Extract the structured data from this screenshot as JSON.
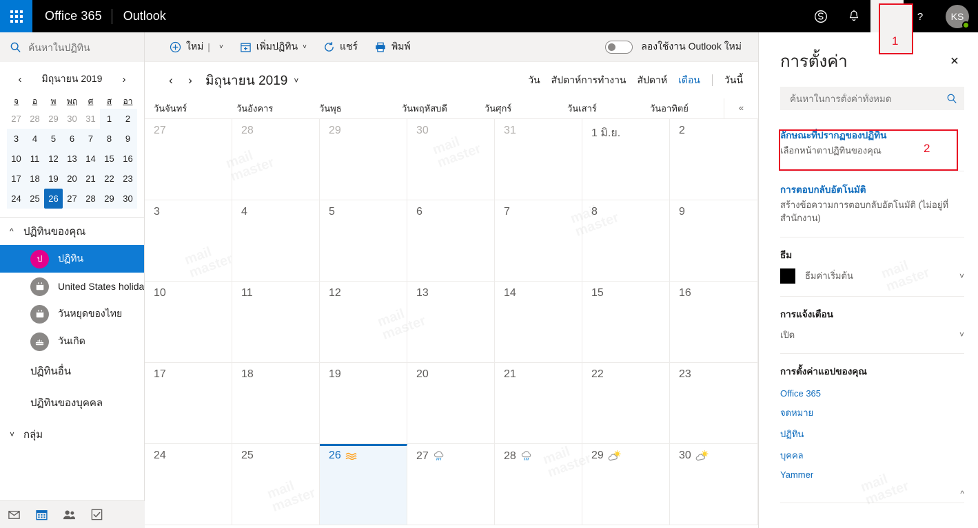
{
  "suite": {
    "waffle_label": "app-launcher",
    "brand": "Office 365",
    "app": "Outlook",
    "skype_icon": "skype-icon",
    "bell_icon": "notifications-icon",
    "gear_icon": "settings-gear-icon",
    "help_icon": "help-icon",
    "avatar_initials": "KS"
  },
  "annotations": {
    "one": "1",
    "two": "2"
  },
  "sidebar": {
    "search_placeholder": "ค้นหาในปฏิทิน",
    "mini_calendar": {
      "title": "มิถุนายน 2019",
      "prev": "‹",
      "next": "›",
      "dow": [
        "จ",
        "อ",
        "พ",
        "พฤ",
        "ศ",
        "ส",
        "อา"
      ],
      "weeks": [
        [
          {
            "d": "27",
            "other": true
          },
          {
            "d": "28",
            "other": true
          },
          {
            "d": "29",
            "other": true
          },
          {
            "d": "30",
            "other": true
          },
          {
            "d": "31",
            "other": true
          },
          {
            "d": "1",
            "other": false
          },
          {
            "d": "2",
            "other": false
          }
        ],
        [
          {
            "d": "3"
          },
          {
            "d": "4"
          },
          {
            "d": "5"
          },
          {
            "d": "6"
          },
          {
            "d": "7"
          },
          {
            "d": "8"
          },
          {
            "d": "9"
          }
        ],
        [
          {
            "d": "10"
          },
          {
            "d": "11"
          },
          {
            "d": "12"
          },
          {
            "d": "13"
          },
          {
            "d": "14"
          },
          {
            "d": "15"
          },
          {
            "d": "16"
          }
        ],
        [
          {
            "d": "17"
          },
          {
            "d": "18"
          },
          {
            "d": "19"
          },
          {
            "d": "20"
          },
          {
            "d": "21"
          },
          {
            "d": "22"
          },
          {
            "d": "23"
          }
        ],
        [
          {
            "d": "24"
          },
          {
            "d": "25"
          },
          {
            "d": "26",
            "today": true
          },
          {
            "d": "27"
          },
          {
            "d": "28"
          },
          {
            "d": "29"
          },
          {
            "d": "30"
          }
        ]
      ]
    },
    "your_calendars_label": "ปฏิทินของคุณ",
    "calendars": [
      {
        "label": "ปฏิทิน",
        "icon": "calendar-badge-icon",
        "badge": "ป",
        "selected": true
      },
      {
        "label": "United States holidays",
        "icon": "calendar-icon",
        "selected": false
      },
      {
        "label": "วันหยุดของไทย",
        "icon": "calendar-icon",
        "selected": false
      },
      {
        "label": "วันเกิด",
        "icon": "birthday-cake-icon",
        "selected": false
      }
    ],
    "other_calendars_label": "ปฏิทินอื่น",
    "people_calendars_label": "ปฏิทินของบุคคล",
    "groups_label": "กลุ่ม",
    "bottom_nav": [
      {
        "name": "mail-icon",
        "active": false
      },
      {
        "name": "calendar-icon",
        "active": true
      },
      {
        "name": "people-icon",
        "active": false
      },
      {
        "name": "tasks-icon",
        "active": false
      }
    ]
  },
  "toolbar": {
    "new_label": "ใหม่",
    "add_calendar_label": "เพิ่มปฏิทิน",
    "share_label": "แชร์",
    "print_label": "พิมพ์",
    "toggle_label": "ลองใช้งาน Outlook ใหม่",
    "toggle_on": false
  },
  "calendar_header": {
    "prev": "‹",
    "next": "›",
    "title": "มิถุนายน 2019",
    "views": [
      {
        "label": "วัน",
        "active": false
      },
      {
        "label": "สัปดาห์การทำงาน",
        "active": false
      },
      {
        "label": "สัปดาห์",
        "active": false
      },
      {
        "label": "เดือน",
        "active": true
      }
    ],
    "today_label": "วันนี้",
    "collapse_icon": "collapse-chevrons-icon"
  },
  "calendar_grid": {
    "day_headers": [
      "วันจันทร์",
      "วันอังคาร",
      "วันพุธ",
      "วันพฤหัสบดี",
      "วันศุกร์",
      "วันเสาร์",
      "วันอาทิตย์"
    ],
    "weeks": [
      [
        {
          "d": "27",
          "other": true
        },
        {
          "d": "28",
          "other": true
        },
        {
          "d": "29",
          "other": true
        },
        {
          "d": "30",
          "other": true
        },
        {
          "d": "31",
          "other": true
        },
        {
          "d": "1 มิ.ย.",
          "other": false
        },
        {
          "d": "2",
          "other": false
        }
      ],
      [
        {
          "d": "3"
        },
        {
          "d": "4"
        },
        {
          "d": "5"
        },
        {
          "d": "6"
        },
        {
          "d": "7"
        },
        {
          "d": "8"
        },
        {
          "d": "9"
        }
      ],
      [
        {
          "d": "10"
        },
        {
          "d": "11"
        },
        {
          "d": "12"
        },
        {
          "d": "13"
        },
        {
          "d": "14"
        },
        {
          "d": "15"
        },
        {
          "d": "16"
        }
      ],
      [
        {
          "d": "17"
        },
        {
          "d": "18"
        },
        {
          "d": "19"
        },
        {
          "d": "20"
        },
        {
          "d": "21"
        },
        {
          "d": "22"
        },
        {
          "d": "23"
        }
      ],
      [
        {
          "d": "24"
        },
        {
          "d": "25"
        },
        {
          "d": "26",
          "today": true,
          "weather": "haze"
        },
        {
          "d": "27",
          "weather": "rain"
        },
        {
          "d": "28",
          "weather": "rain"
        },
        {
          "d": "29",
          "weather": "partly-sunny"
        },
        {
          "d": "30",
          "weather": "partly-sunny"
        }
      ]
    ]
  },
  "settings": {
    "title": "การตั้งค่า",
    "close_icon": "close-icon",
    "search_placeholder": "ค้นหาในการตั้งค่าทั้งหมด",
    "search_icon": "search-icon",
    "rows": [
      {
        "title": "ลักษณะที่ปรากฏของปฏิทิน",
        "desc": "เลือกหน้าตาปฏิทินของคุณ"
      },
      {
        "title": "การตอบกลับอัตโนมัติ",
        "desc": "สร้างข้อความการตอบกลับอัตโนมัติ (ไม่อยู่ที่สำนักงาน)"
      }
    ],
    "theme_label": "ธีม",
    "theme_value": "ธีมค่าเริ่มต้น",
    "theme_swatch": "#000000",
    "notifications_label": "การแจ้งเตือน",
    "notifications_value": "เปิด",
    "app_settings_label": "การตั้งค่าแอปของคุณ",
    "app_links": [
      "Office 365",
      "จดหมาย",
      "ปฏิทิน",
      "บุคคล",
      "Yammer"
    ]
  },
  "colors": {
    "accent": "#0f6cbd",
    "suitebar": "#000000",
    "waffle": "#0078d4",
    "annotation": "#e81123",
    "selected_calendar": "#0f7bd4",
    "pink_badge": "#e3008c"
  }
}
